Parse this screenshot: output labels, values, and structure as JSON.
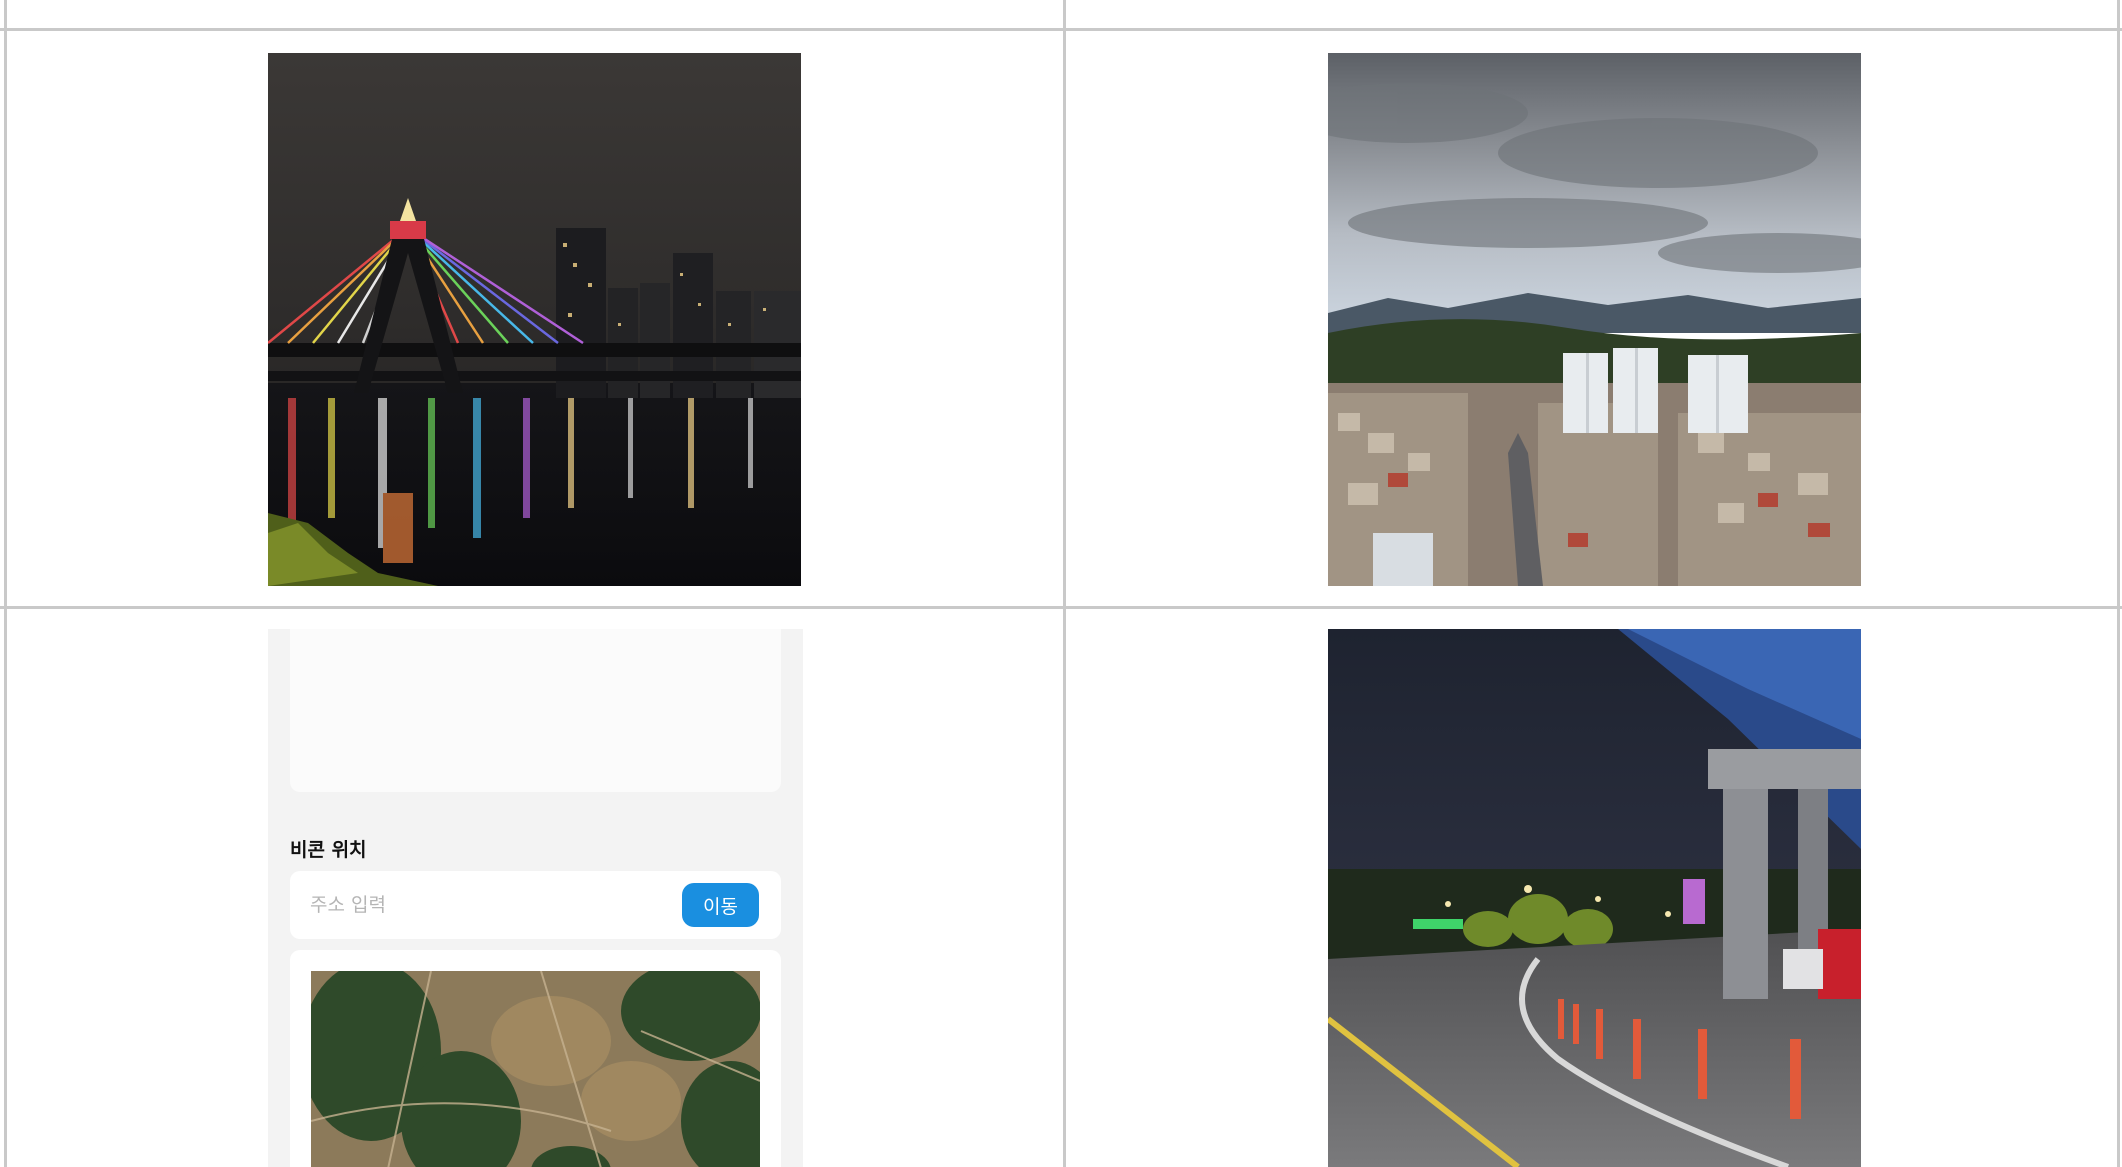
{
  "photos": [
    {
      "name": "night-bridge-photo"
    },
    {
      "name": "city-skyline-photo"
    },
    {
      "name": "night-road-photo"
    }
  ],
  "phone_ui": {
    "beacon_section_title": "비콘 위치",
    "address_placeholder": "주소 입력",
    "address_value": "",
    "go_button_label": "이동"
  },
  "colors": {
    "button_blue": "#1a8fe0",
    "grid_line": "#c9c9c9",
    "panel_bg": "#f3f3f3"
  }
}
